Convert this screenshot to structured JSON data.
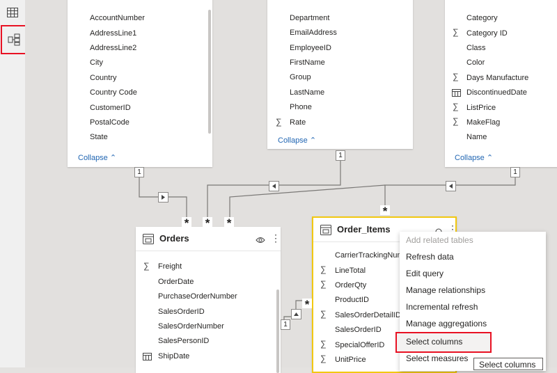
{
  "sidebar": {
    "items": [
      {
        "icon": "table-view-icon"
      },
      {
        "icon": "model-view-icon",
        "selected": true
      }
    ]
  },
  "tables": {
    "customer": {
      "fields": [
        "AccountNumber",
        "AddressLine1",
        "AddressLine2",
        "City",
        "Country",
        "Country Code",
        "CustomerID",
        "PostalCode",
        "State"
      ],
      "collapse": "Collapse"
    },
    "employee": {
      "fields": [
        "Department",
        "EmailAddress",
        "EmployeeID",
        "FirstName",
        "Group",
        "LastName",
        "Phone",
        "Rate"
      ],
      "collapse": "Collapse"
    },
    "product": {
      "fields": [
        "Category",
        "Category ID",
        "Class",
        "Color",
        "Days Manufacture",
        "DiscontinuedDate",
        "ListPrice",
        "MakeFlag",
        "Name"
      ],
      "collapse": "Collapse"
    },
    "orders": {
      "title": "Orders",
      "fields": [
        "Freight",
        "OrderDate",
        "PurchaseOrderNumber",
        "SalesOrderID",
        "SalesOrderNumber",
        "SalesPersonID",
        "ShipDate"
      ]
    },
    "order_items": {
      "title": "Order_Items",
      "fields": [
        "CarrierTrackingNum",
        "LineTotal",
        "OrderQty",
        "ProductID",
        "SalesOrderDetailID",
        "SalesOrderID",
        "SpecialOfferID",
        "UnitPrice"
      ]
    }
  },
  "relationships": {
    "one": "1",
    "many": "*"
  },
  "context_menu": {
    "items": [
      "Add related tables",
      "Refresh data",
      "Edit query",
      "Manage relationships",
      "Incremental refresh",
      "Manage aggregations",
      "Select columns",
      "Select measures"
    ]
  },
  "tooltip": "Select columns",
  "colors": {
    "selected_outline": "#e81123",
    "selected_table_border": "#f2c811",
    "link": "#2166b3"
  }
}
